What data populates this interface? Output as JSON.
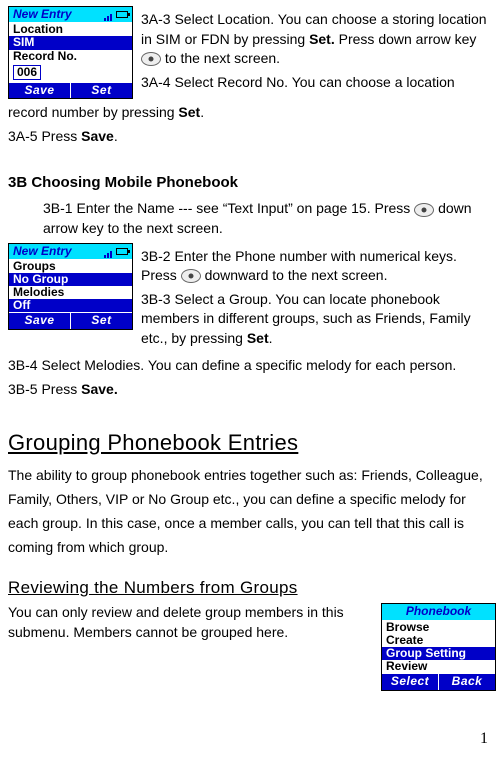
{
  "phone1": {
    "title": "New Entry",
    "rows": [
      "Location",
      "SIM",
      "Record No."
    ],
    "num": "006",
    "soft_left": "Save",
    "soft_right": "Set"
  },
  "phone2": {
    "title": "New Entry",
    "rows": [
      "Groups",
      "No Group",
      "Melodies",
      "Off"
    ],
    "sel_indices": [
      1,
      3
    ],
    "soft_left": "Save",
    "soft_right": "Set"
  },
  "phone3": {
    "title": "Phonebook",
    "rows": [
      "Browse",
      "Create",
      "Group Setting",
      "Review"
    ],
    "sel_indices": [
      2
    ],
    "soft_left": "Select",
    "soft_right": "Back"
  },
  "top": {
    "p3a3_a": "3A-3 Select Location. You can choose a storing location in SIM or FDN by pressing ",
    "p3a3_b": "Set.",
    "p3a3_c": " Press down arrow key ",
    "p3a3_d": " to the next screen.",
    "p3a4_a": "3A-4 Select Record No. You can choose a location record number by pressing ",
    "p3a4_b": "Set",
    "p3a4_c": ".",
    "p3a5_a": "3A-5 Press ",
    "p3a5_b": "Save",
    "p3a5_c": "."
  },
  "secB": {
    "heading": "3B  Choosing Mobile Phonebook",
    "b1_a": "3B-1 Enter the Name --- see “Text Input” on page 15. Press ",
    "b1_b": " down arrow key to the next screen.",
    "b2_a": "3B-2 Enter the Phone number with numerical keys. Press ",
    "b2_b": " downward to the next screen.",
    "b3_a": "3B-3 Select a Group. You can locate phonebook members in different groups, such as Friends, Family etc., by pressing ",
    "b3_b": "Set",
    "b3_c": ".",
    "b4": "3B-4 Select Melodies. You can define a specific melody for each person.",
    "b5_a": "3B-5 Press ",
    "b5_b": "Save."
  },
  "grouping": {
    "heading": "Grouping Phonebook Entries",
    "para": "The ability to group phonebook entries together such as: Friends, Colleague, Family, Others, VIP or No Group etc., you can define a specific melody for each group. In this case, once a member calls, you can tell that this call is coming from which group."
  },
  "review": {
    "heading": "Reviewing the Numbers from Groups",
    "para": "You can only review and delete group members in this submenu. Members cannot be grouped here."
  },
  "page_number": "1"
}
